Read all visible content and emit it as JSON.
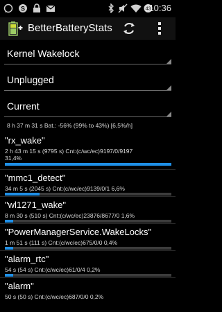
{
  "status_bar": {
    "time": "10:36",
    "battery_level": "43",
    "left_icons": [
      "whatsapp-icon",
      "skype-icon",
      "lock-icon",
      "mail-icon"
    ],
    "right_icons": [
      "bluetooth-icon",
      "mute-icon",
      "wifi-icon",
      "battery-icon"
    ]
  },
  "action_bar": {
    "title": "BetterBatteryStats",
    "icons": [
      "app-battery-icon",
      "refresh-icon",
      "overflow-menu-icon"
    ]
  },
  "spinners": [
    {
      "selected": "Kernel Wakelock"
    },
    {
      "selected": "Unplugged"
    },
    {
      "selected": "Current"
    }
  ],
  "summary": "8 h 37 m 31 s  Bat.: -56% (99% to 43%) [6,5%/h]",
  "items": [
    {
      "title": "\"rx_wake\"",
      "detail": "2 h 43 m 15 s  (9795 s) Cnt:(c/wc/ec)9197/0/9197",
      "detail2": "31,4%",
      "share": 0.314
    },
    {
      "title": "\"mmc1_detect\"",
      "detail": "34 m 5 s  (2045 s) Cnt:(c/wc/ec)9139/0/1 6,6%",
      "detail2": "",
      "share": 0.066
    },
    {
      "title": "\"wl1271_wake\"",
      "detail": "8 m 30 s  (510 s) Cnt:(c/wc/ec)23876/8677/0 1,6%",
      "detail2": "",
      "share": 0.016
    },
    {
      "title": "\"PowerManagerService.WakeLocks\"",
      "detail": "1 m 51 s  (111 s) Cnt:(c/wc/ec)675/0/0 0,4%",
      "detail2": "",
      "share": 0.004
    },
    {
      "title": "\"alarm_rtc\"",
      "detail": "54 s  (54 s) Cnt:(c/wc/ec)61/0/4 0,2%",
      "detail2": "",
      "share": 0.002
    },
    {
      "title": "\"alarm\"",
      "detail": "50 s  (50 s) Cnt:(c/wc/ec)687/0/0 0,2%",
      "detail2": "",
      "share": 0.002
    }
  ],
  "colors": {
    "accent": "#1f8fe6",
    "background": "#000000",
    "bar_track": "#3c3c3c"
  }
}
